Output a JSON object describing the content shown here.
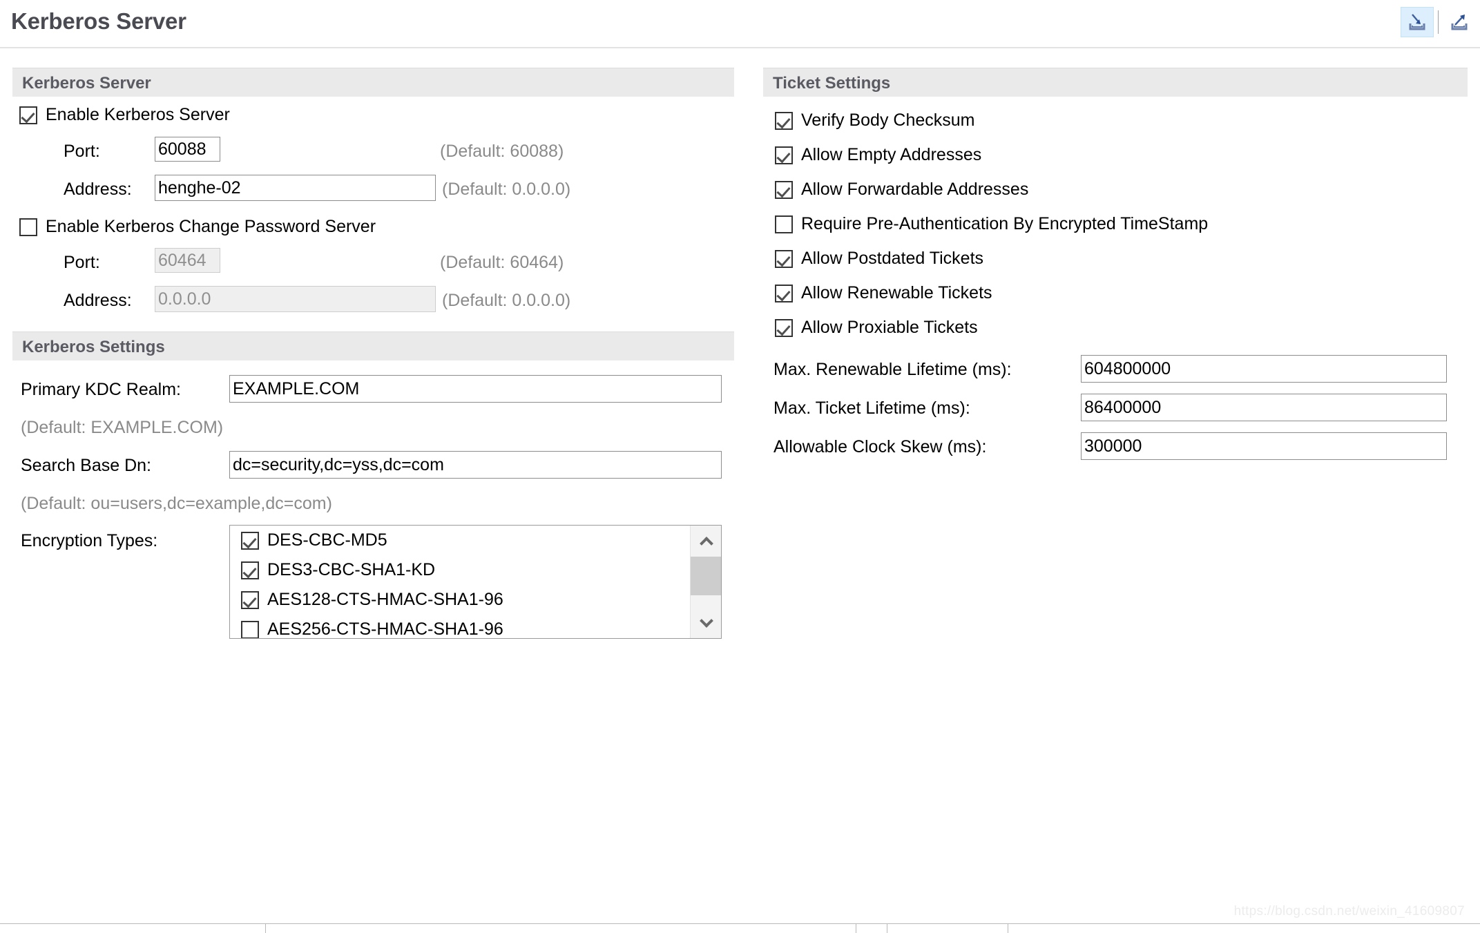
{
  "window": {
    "title": "Kerberos Server",
    "toolbar": [
      {
        "name": "import-icon",
        "label": "Import",
        "active": true
      },
      {
        "name": "export-icon",
        "label": "Export",
        "active": false
      }
    ]
  },
  "left_panel": {
    "server_section": {
      "header": "Kerberos Server",
      "enable_server": {
        "label": "Enable Kerberos Server",
        "checked": true
      },
      "port": {
        "label": "Port:",
        "value": "60088",
        "default_hint": "(Default: 60088)",
        "enabled": true
      },
      "address": {
        "label": "Address:",
        "value": "henghe-02",
        "default_hint": "(Default: 0.0.0.0)",
        "enabled": true
      },
      "enable_changepw": {
        "label": "Enable Kerberos Change Password Server",
        "checked": false
      },
      "changepw_port": {
        "label": "Port:",
        "value": "60464",
        "default_hint": "(Default: 60464)",
        "enabled": false
      },
      "changepw_address": {
        "label": "Address:",
        "value": "0.0.0.0",
        "default_hint": "(Default: 0.0.0.0)",
        "enabled": false
      }
    },
    "settings_section": {
      "header": "Kerberos Settings",
      "kdc_realm": {
        "label": "Primary KDC Realm:",
        "value": "EXAMPLE.COM",
        "default_hint": "(Default: EXAMPLE.COM)"
      },
      "search_base_dn": {
        "label": "Search Base Dn:",
        "value": "dc=security,dc=yss,dc=com",
        "default_hint": "(Default: ou=users,dc=example,dc=com)"
      },
      "encryption_types": {
        "label": "Encryption Types:",
        "items": [
          {
            "label": "DES-CBC-MD5",
            "checked": true
          },
          {
            "label": "DES3-CBC-SHA1-KD",
            "checked": true
          },
          {
            "label": "AES128-CTS-HMAC-SHA1-96",
            "checked": true
          },
          {
            "label": "AES256-CTS-HMAC-SHA1-96",
            "checked": false
          }
        ]
      }
    }
  },
  "right_panel": {
    "header": "Ticket Settings",
    "checkboxes": [
      {
        "label": "Verify Body Checksum",
        "checked": true
      },
      {
        "label": "Allow Empty Addresses",
        "checked": true
      },
      {
        "label": "Allow Forwardable Addresses",
        "checked": true
      },
      {
        "label": "Require Pre-Authentication By Encrypted TimeStamp",
        "checked": false
      },
      {
        "label": "Allow Postdated Tickets",
        "checked": true
      },
      {
        "label": "Allow Renewable Tickets",
        "checked": true
      },
      {
        "label": "Allow Proxiable Tickets",
        "checked": true
      }
    ],
    "fields": [
      {
        "label": "Max. Renewable Lifetime (ms):",
        "value": "604800000"
      },
      {
        "label": "Max. Ticket Lifetime (ms):",
        "value": "86400000"
      },
      {
        "label": "Allowable Clock Skew (ms):",
        "value": "300000"
      }
    ]
  },
  "watermark": "https://blog.csdn.net/weixin_41609807",
  "colors": {
    "band": "#eaeaea",
    "title_text": "#4a4a52",
    "hint_text": "#8a8a8a",
    "tool_active_bg": "#ddeffc"
  }
}
